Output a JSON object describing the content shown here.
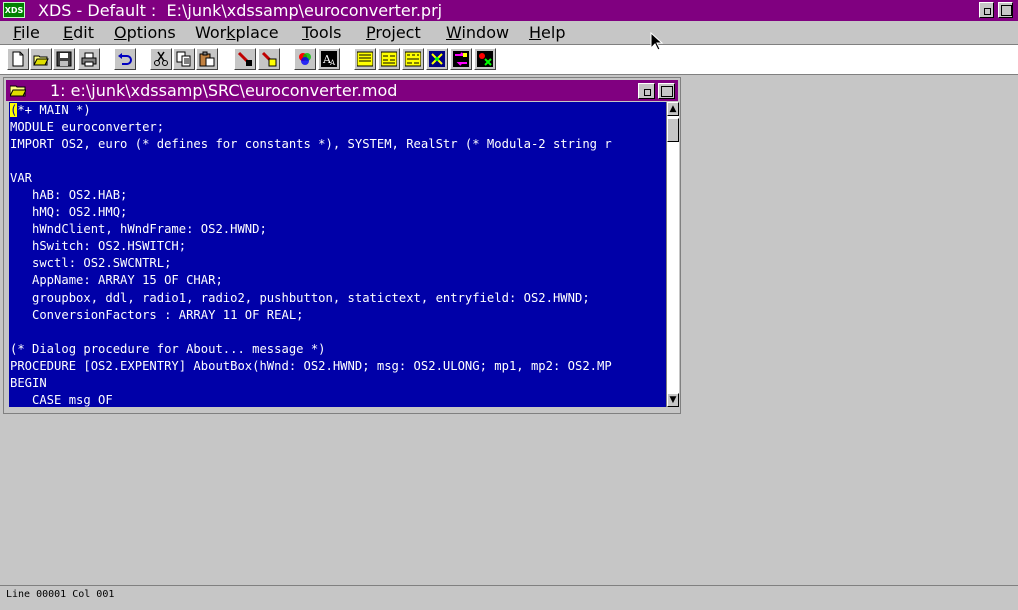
{
  "titlebar": {
    "icon_text": "XDS",
    "title": "XDS - Default :  E:\\junk\\xdssamp\\euroconverter.prj"
  },
  "menu": [
    {
      "key": "F",
      "rest": "ile"
    },
    {
      "key": "E",
      "rest": "dit"
    },
    {
      "key": "O",
      "rest": "ptions"
    },
    {
      "pre": "Wor",
      "key": "k",
      "rest": "place"
    },
    {
      "key": "T",
      "rest": "ools"
    },
    {
      "key": "P",
      "rest": "roject"
    },
    {
      "key": "W",
      "rest": "indow"
    },
    {
      "key": "H",
      "rest": "elp"
    }
  ],
  "toolbar": {
    "icons": [
      "new-file-icon",
      "open-file-icon",
      "save-icon",
      "print-icon",
      "undo-icon",
      "cut-icon",
      "copy-icon",
      "paste-icon",
      "find-icon",
      "replace-icon",
      "color-icon",
      "font-icon",
      "compile-icon",
      "make-icon",
      "build-icon",
      "debug-icon",
      "tool-icon",
      "run-icon"
    ]
  },
  "editor": {
    "title": "1: e:\\junk\\xdssamp\\SRC\\euroconverter.mod",
    "cursor_char": "(",
    "lines": [
      "*+ MAIN *)",
      "MODULE euroconverter;",
      "IMPORT OS2, euro (* defines for constants *), SYSTEM, RealStr (* Modula-2 string r",
      "",
      "VAR",
      "   hAB: OS2.HAB;",
      "   hMQ: OS2.HMQ;",
      "   hWndClient, hWndFrame: OS2.HWND;",
      "   hSwitch: OS2.HSWITCH;",
      "   swctl: OS2.SWCNTRL;",
      "   AppName: ARRAY 15 OF CHAR;",
      "   groupbox, ddl, radio1, radio2, pushbutton, statictext, entryfield: OS2.HWND;",
      "   ConversionFactors : ARRAY 11 OF REAL;",
      "",
      "(* Dialog procedure for About... message *)",
      "PROCEDURE [OS2.EXPENTRY] AboutBox(hWnd: OS2.HWND; msg: OS2.ULONG; mp1, mp2: OS2.MP",
      "BEGIN",
      "   CASE msg OF"
    ]
  },
  "status": {
    "text": "Line 00001 Col 001"
  }
}
